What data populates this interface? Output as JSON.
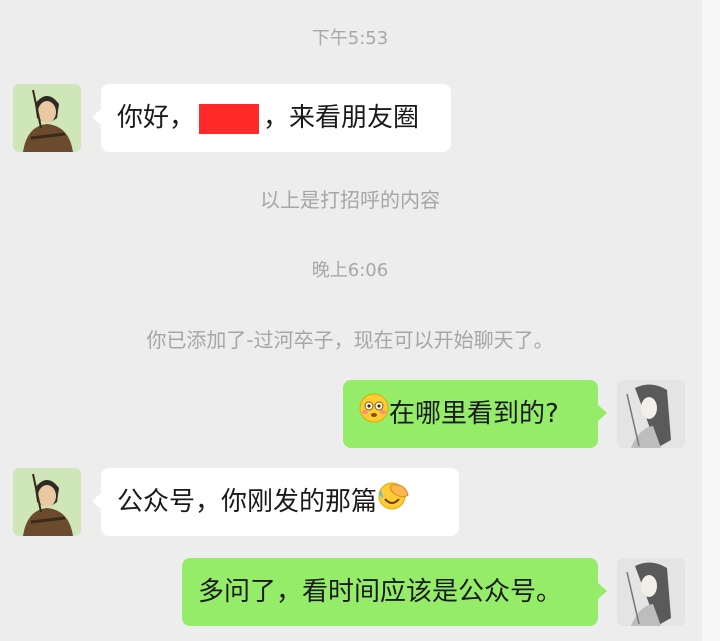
{
  "timestamps": {
    "first": "下午5:53",
    "second": "晚上6:06"
  },
  "system": {
    "greeting_note": "以上是打招呼的内容",
    "added_notice": "你已添加了-过河卒子，现在可以开始聊天了。"
  },
  "messages": [
    {
      "side": "left",
      "before": "你好，",
      "after": "，来看朋友圈",
      "redacted": true
    },
    {
      "side": "right",
      "text": "在哪里看到的?",
      "emoji": "flushed-face"
    },
    {
      "side": "left",
      "text": "公众号，你刚发的那篇",
      "emoji": "facepalm"
    },
    {
      "side": "right",
      "text": "多问了，看时间应该是公众号。"
    }
  ],
  "colors": {
    "background": "#ededed",
    "bubble_self": "#95ec69",
    "bubble_other": "#ffffff",
    "redaction": "#ff2a2a"
  }
}
